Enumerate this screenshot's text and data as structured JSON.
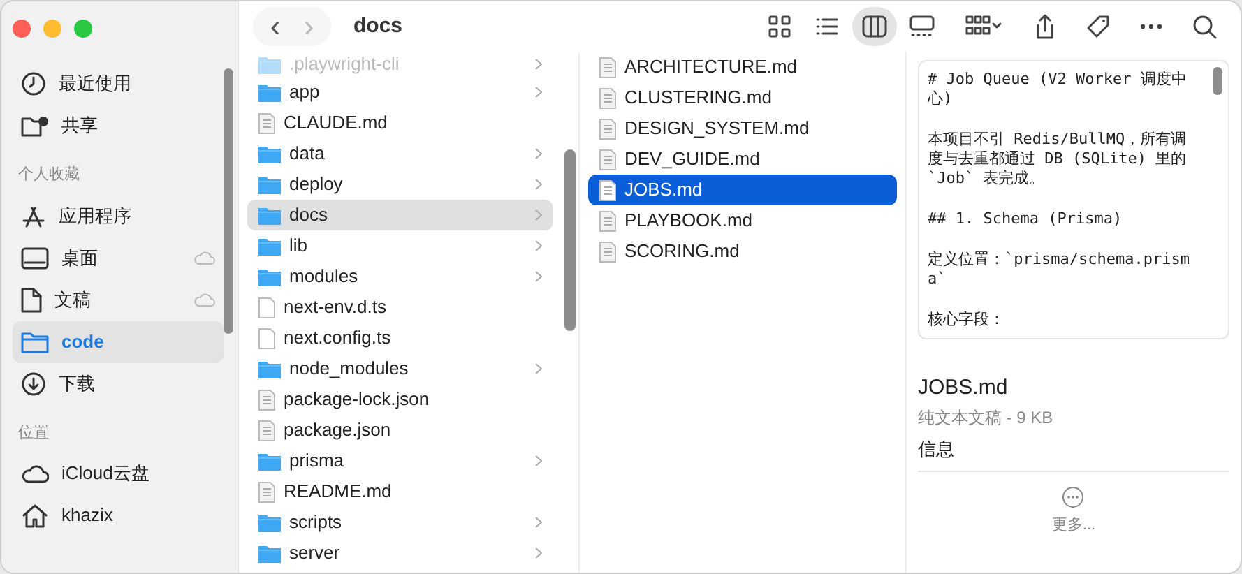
{
  "window": {
    "title": "docs"
  },
  "toolbar": {
    "back": "‹",
    "forward": "›",
    "views": [
      {
        "kind": "icons",
        "selected": false
      },
      {
        "kind": "list",
        "selected": false
      },
      {
        "kind": "columns",
        "selected": true
      },
      {
        "kind": "gallery",
        "selected": false
      }
    ]
  },
  "sidebar": {
    "sections": [
      {
        "items": [
          {
            "label": "最近使用",
            "kind": "recents",
            "selected": false,
            "icloud": false
          },
          {
            "label": "共享",
            "kind": "shared",
            "selected": false,
            "icloud": false
          }
        ]
      },
      {
        "header": "个人收藏",
        "items": [
          {
            "label": "应用程序",
            "kind": "applications",
            "selected": false,
            "icloud": false
          },
          {
            "label": "桌面",
            "kind": "desktop",
            "selected": false,
            "icloud": true
          },
          {
            "label": "文稿",
            "kind": "documents",
            "selected": false,
            "icloud": true
          },
          {
            "label": "code",
            "kind": "folder",
            "selected": true,
            "icloud": false
          },
          {
            "label": "下载",
            "kind": "downloads",
            "selected": false,
            "icloud": false
          }
        ]
      },
      {
        "header": "位置",
        "items": [
          {
            "label": "iCloud云盘",
            "kind": "icloud",
            "selected": false,
            "icloud": false
          },
          {
            "label": "khazix",
            "kind": "home",
            "selected": false,
            "icloud": false
          }
        ]
      }
    ]
  },
  "columns": [
    {
      "focused": false,
      "items": [
        {
          "name": ".playwright-cli",
          "kind": "folder",
          "faded": true,
          "selected": false
        },
        {
          "name": "app",
          "kind": "folder",
          "faded": false,
          "selected": false
        },
        {
          "name": "CLAUDE.md",
          "kind": "text",
          "faded": false,
          "selected": false
        },
        {
          "name": "data",
          "kind": "folder",
          "faded": false,
          "selected": false
        },
        {
          "name": "deploy",
          "kind": "folder",
          "faded": false,
          "selected": false
        },
        {
          "name": "docs",
          "kind": "folder",
          "faded": false,
          "selected": true
        },
        {
          "name": "lib",
          "kind": "folder",
          "faded": false,
          "selected": false
        },
        {
          "name": "modules",
          "kind": "folder",
          "faded": false,
          "selected": false
        },
        {
          "name": "next-env.d.ts",
          "kind": "blank",
          "faded": false,
          "selected": false
        },
        {
          "name": "next.config.ts",
          "kind": "blank",
          "faded": false,
          "selected": false
        },
        {
          "name": "node_modules",
          "kind": "folder",
          "faded": false,
          "selected": false
        },
        {
          "name": "package-lock.json",
          "kind": "text",
          "faded": false,
          "selected": false
        },
        {
          "name": "package.json",
          "kind": "text",
          "faded": false,
          "selected": false
        },
        {
          "name": "prisma",
          "kind": "folder",
          "faded": false,
          "selected": false
        },
        {
          "name": "README.md",
          "kind": "text",
          "faded": false,
          "selected": false
        },
        {
          "name": "scripts",
          "kind": "folder",
          "faded": false,
          "selected": false
        },
        {
          "name": "server",
          "kind": "folder",
          "faded": false,
          "selected": false
        }
      ]
    },
    {
      "focused": true,
      "items": [
        {
          "name": "ARCHITECTURE.md",
          "kind": "text",
          "faded": false,
          "selected": false
        },
        {
          "name": "CLUSTERING.md",
          "kind": "text",
          "faded": false,
          "selected": false
        },
        {
          "name": "DESIGN_SYSTEM.md",
          "kind": "text",
          "faded": false,
          "selected": false
        },
        {
          "name": "DEV_GUIDE.md",
          "kind": "text",
          "faded": false,
          "selected": false
        },
        {
          "name": "JOBS.md",
          "kind": "text",
          "faded": false,
          "selected": true
        },
        {
          "name": "PLAYBOOK.md",
          "kind": "text",
          "faded": false,
          "selected": false
        },
        {
          "name": "SCORING.md",
          "kind": "text",
          "faded": false,
          "selected": false
        }
      ]
    }
  ],
  "preview": {
    "text": "# Job Queue (V2 Worker 调度中心)\n\n本项目不引 Redis/BullMQ，所有调度与去重都通过 DB (SQLite) 里的 `Job` 表完成。\n\n## 1. Schema (Prisma)\n\n定义位置：`prisma/schema.prisma`\n\n核心字段：",
    "file_name": "JOBS.md",
    "file_info": "纯文本文稿 - 9 KB",
    "section": "信息",
    "more": "更多..."
  }
}
